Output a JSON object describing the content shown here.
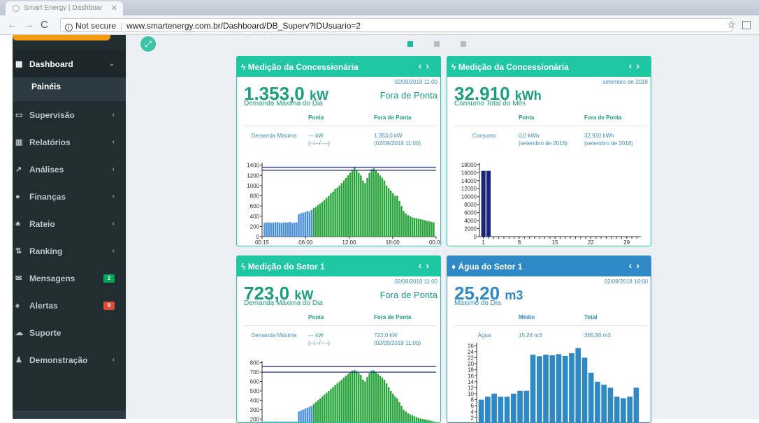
{
  "browser": {
    "tab_title": "Smart Energy | Dashboar",
    "tab_close": "✕",
    "security_label": "Not secure",
    "url": "www.smartenergy.com.br/Dashboard/DB_Superv?IDUsuario=2"
  },
  "sidebar": {
    "items": [
      {
        "label": "Dashboard",
        "icon": "dashboard-icon",
        "glyph": "▦",
        "chevron": "⌄"
      },
      {
        "label": "Supervisão",
        "icon": "desktop-icon",
        "glyph": "▭",
        "chevron": "‹"
      },
      {
        "label": "Relatórios",
        "icon": "bar-chart-icon",
        "glyph": "▥",
        "chevron": "‹"
      },
      {
        "label": "Análises",
        "icon": "line-chart-icon",
        "glyph": "↗",
        "chevron": "‹"
      },
      {
        "label": "Finanças",
        "icon": "coins-icon",
        "glyph": "●",
        "chevron": "‹"
      },
      {
        "label": "Rateio",
        "icon": "sitemap-icon",
        "glyph": "♣",
        "chevron": "‹"
      },
      {
        "label": "Ranking",
        "icon": "sort-icon",
        "glyph": "⇅",
        "chevron": "‹"
      },
      {
        "label": "Mensagens",
        "icon": "envelope-icon",
        "glyph": "✉",
        "badge": "2"
      },
      {
        "label": "Alertas",
        "icon": "bell-icon",
        "glyph": "♠",
        "badge": "9"
      },
      {
        "label": "Suporte",
        "icon": "chat-icon",
        "glyph": "☁"
      },
      {
        "label": "Demonstração",
        "icon": "user-icon",
        "glyph": "♟",
        "chevron": "‹"
      }
    ],
    "submenu_label": "Painéis"
  },
  "colors": {
    "accent": "#1ec7a2",
    "blue": "#2f89c5",
    "sidebar": "#222d32",
    "bar_green": "#27a43a",
    "bar_blue": "#4a90d9",
    "bar_navy": "#1a237e"
  },
  "panels": {
    "p1": {
      "title": "Medição da Concessionária",
      "timestamp": "02/09/2018 11:00",
      "value": "1.353,0",
      "unit": "kW",
      "value_label": "Demanda Máxima do Dia",
      "side_label": "Fora de Ponta",
      "headers": [
        "",
        "Ponta",
        "Fora de Ponta"
      ],
      "row": {
        "label": "Demanda Máxima",
        "c1": "--- kW",
        "c1_sub": "(--/--/----)",
        "c2": "1.353,0 kW",
        "c2_sub": "(02/09/2018 11:00)"
      }
    },
    "p2": {
      "title": "Medição da Concessionária",
      "timestamp": "setembro de 2018",
      "value": "32.910",
      "unit": "kWh",
      "value_label": "Consumo Total do Mês",
      "headers": [
        "",
        "Ponta",
        "Fora de Ponta"
      ],
      "row": {
        "label": "Consumo",
        "c1": "0,0 kWh",
        "c1_sub": "(setembro de 2018)",
        "c2": "32.910 kWh",
        "c2_sub": "(setembro de 2018)"
      }
    },
    "p3": {
      "title": "Medição do Setor 1",
      "timestamp": "02/09/2018 11:00",
      "value": "723,0",
      "unit": "kW",
      "value_label": "Demanda Máxima do Dia",
      "side_label": "Fora de Ponta",
      "headers": [
        "",
        "Ponta",
        "Fora de Ponta"
      ],
      "row": {
        "label": "Demanda Máxima",
        "c1": "--- kW",
        "c1_sub": "(--/--/----)",
        "c2": "723,0 kW",
        "c2_sub": "(02/09/2018 11:00)"
      }
    },
    "p4": {
      "title": "Água do Setor 1",
      "timestamp": "02/09/2018 16:00",
      "value": "25,20",
      "unit": "m3",
      "value_label": "Máximo do Dia",
      "headers": [
        "",
        "Médio",
        "Total"
      ],
      "row": {
        "label": "Água",
        "c1": "15,24 m3",
        "c1_sub": "",
        "c2": "365,80 m3",
        "c2_sub": ""
      }
    }
  },
  "chart_data": [
    {
      "type": "bar",
      "x_ticks": [
        "00:15",
        "06:00",
        "12:00",
        "18:00",
        "00:00"
      ],
      "y_ticks": [
        0,
        200,
        400,
        600,
        800,
        1000,
        1200,
        1400
      ],
      "ylim": [
        0,
        1450
      ],
      "reference_lines": [
        1300,
        1360
      ],
      "values": [
        270,
        275,
        280,
        270,
        275,
        280,
        285,
        275,
        270,
        280,
        275,
        280,
        285,
        270,
        275,
        280,
        440,
        460,
        470,
        480,
        500,
        490,
        520,
        560,
        580,
        620,
        650,
        680,
        720,
        760,
        800,
        850,
        880,
        930,
        960,
        1000,
        1050,
        1100,
        1150,
        1200,
        1250,
        1300,
        1353,
        1300,
        1250,
        1200,
        1100,
        1050,
        1150,
        1250,
        1320,
        1340,
        1300,
        1250,
        1200,
        1150,
        1100,
        1000,
        950,
        900,
        850,
        800,
        800,
        700,
        600,
        500,
        450,
        420,
        400,
        380,
        370,
        360,
        350,
        340,
        330,
        320,
        310,
        300,
        290,
        280
      ]
    },
    {
      "type": "bar",
      "x_ticks": [
        "1",
        "8",
        "15",
        "22",
        "29"
      ],
      "y_ticks": [
        0,
        2000,
        4000,
        6000,
        8000,
        10000,
        12000,
        14000,
        16000,
        18000
      ],
      "ylim": [
        0,
        18500
      ],
      "values": [
        16455,
        16455
      ]
    },
    {
      "type": "bar",
      "x_ticks": [],
      "y_ticks": [
        200,
        300,
        400,
        500,
        600,
        700,
        800
      ],
      "ylim": [
        150,
        820
      ],
      "reference_lines": [
        700,
        760
      ],
      "values": [
        170,
        170,
        172,
        171,
        170,
        172,
        171,
        170,
        172,
        171,
        170,
        172,
        171,
        170,
        172,
        171,
        280,
        290,
        300,
        310,
        320,
        330,
        340,
        360,
        380,
        400,
        420,
        440,
        460,
        480,
        500,
        520,
        540,
        560,
        580,
        600,
        620,
        640,
        660,
        680,
        700,
        715,
        723,
        710,
        690,
        670,
        620,
        600,
        650,
        690,
        715,
        720,
        700,
        680,
        660,
        640,
        620,
        580,
        540,
        500,
        470,
        440,
        420,
        380,
        340,
        300,
        280,
        260,
        250,
        240,
        230,
        220,
        210,
        205,
        200,
        195,
        190,
        185,
        180,
        175
      ]
    },
    {
      "type": "bar",
      "y_ticks": [
        2,
        4,
        6,
        8,
        10,
        12,
        14,
        16,
        18,
        20,
        22,
        24,
        26
      ],
      "ylim": [
        0,
        27
      ],
      "values": [
        8,
        9,
        10,
        9,
        9,
        10,
        11,
        11,
        23,
        22.5,
        23,
        22.8,
        23.2,
        22.6,
        23.5,
        25.2,
        22,
        17,
        14,
        13,
        12,
        9,
        8.5,
        9,
        12
      ]
    }
  ]
}
